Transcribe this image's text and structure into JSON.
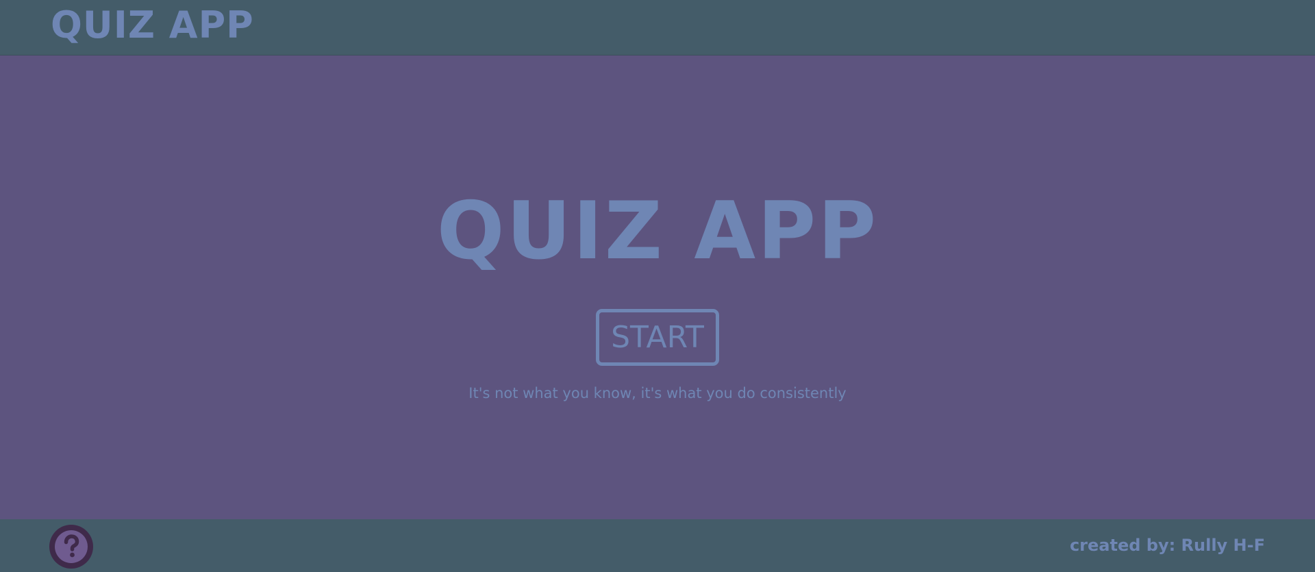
{
  "header": {
    "title": "QUIZ APP"
  },
  "main": {
    "title": "QUIZ APP",
    "start_label": "START",
    "tagline": "It's not what you know, it's what you do consistently"
  },
  "footer": {
    "help_icon": "question-circle-icon",
    "credit": "created by: Rully H-F"
  },
  "colors": {
    "header_bg": "#445c69",
    "main_bg": "#5d547f",
    "accent": "#6f86b4",
    "help_bg": "#3f2a4a"
  }
}
